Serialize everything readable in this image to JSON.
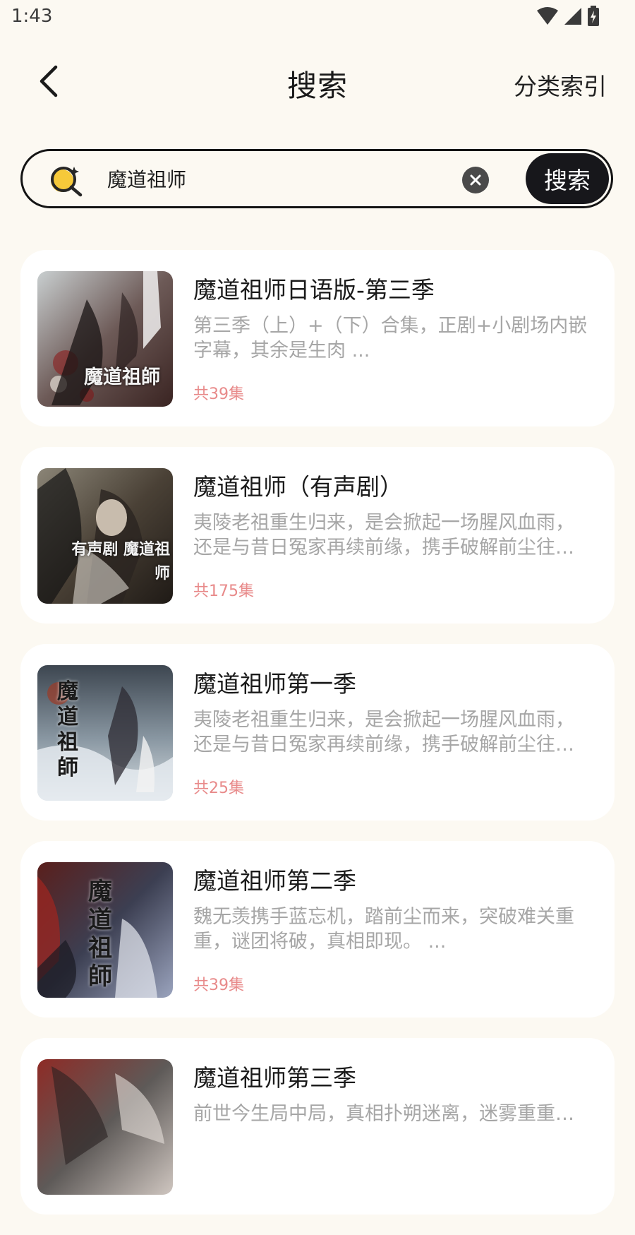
{
  "status_bar": {
    "time": "1:43"
  },
  "header": {
    "title": "搜索",
    "category_link": "分类索引"
  },
  "search": {
    "query": "魔道祖师",
    "button_label": "搜索"
  },
  "results": [
    {
      "title": "魔道祖师日语版-第三季",
      "description": "第三季（上）+（下）合集，正剧+小剧场内嵌字幕，其余是生肉 ...",
      "episode_count": "共39集",
      "cover_text": "魔道祖師"
    },
    {
      "title": "魔道祖师（有声剧）",
      "description": "夷陵老祖重生归来，是会掀起一场腥风血雨，还是与昔日冤家再续前缘，携手破解前尘往事…",
      "episode_count": "共175集",
      "cover_text": "有声剧 魔道祖师"
    },
    {
      "title": "魔道祖师第一季",
      "description": "夷陵老祖重生归来，是会掀起一场腥风血雨，还是与昔日冤家再续前缘，携手破解前尘往事…",
      "episode_count": "共25集",
      "cover_text": "魔道祖師"
    },
    {
      "title": "魔道祖师第二季",
      "description": "魏无羡携手蓝忘机，踏前尘而来，突破难关重重，谜团将破，真相即现。 ...",
      "episode_count": "共39集",
      "cover_text": "魔道祖師"
    },
    {
      "title": "魔道祖师第三季",
      "description": "前世今生局中局，真相扑朔迷离，迷雾重重…",
      "episode_count": "",
      "cover_text": ""
    }
  ],
  "colors": {
    "background": "#fcf9f2",
    "card": "#ffffff",
    "accent_dark": "#17171b",
    "episode_count": "#e88a8a",
    "description": "#a6a6a6"
  }
}
